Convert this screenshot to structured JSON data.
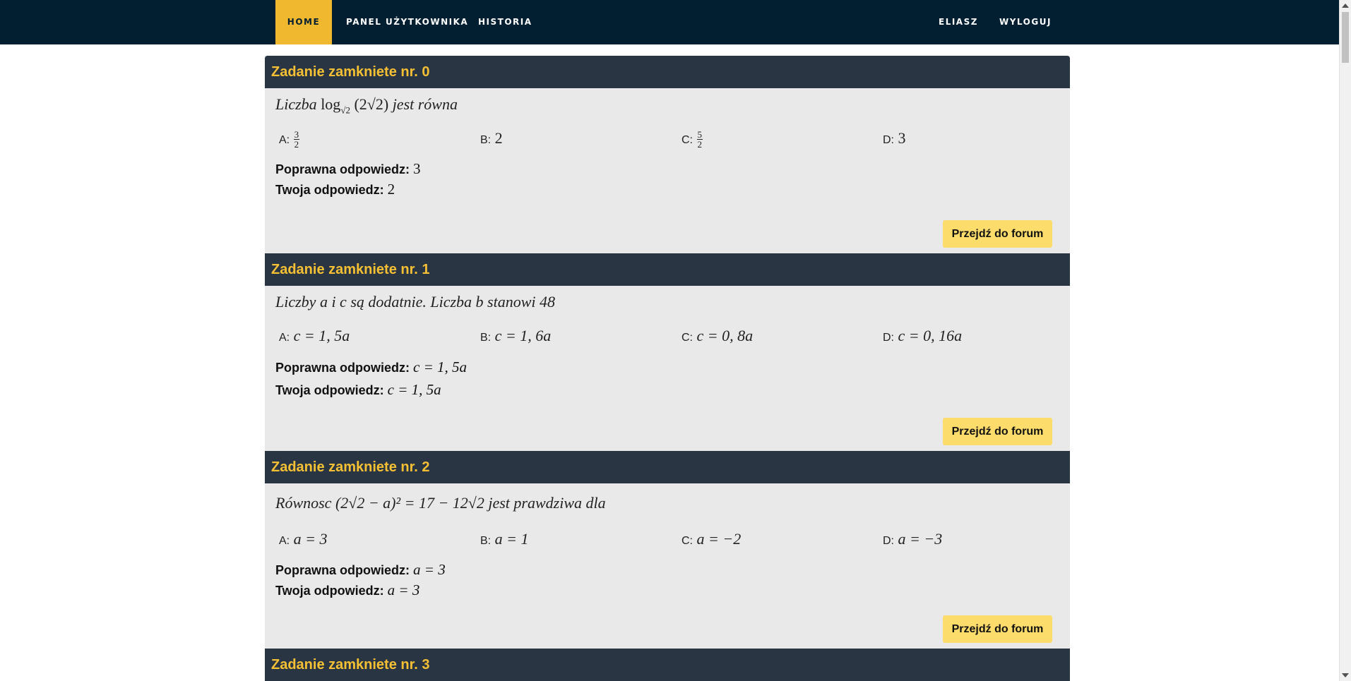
{
  "nav": {
    "left": [
      "HOME",
      "PANEL UŻYTKOWNIKA",
      "HISTORIA"
    ],
    "right": [
      "ELIASZ",
      "WYLOGUJ"
    ]
  },
  "tasks": [
    {
      "title": "Zadanie zamkniete nr. 0",
      "question_prefix": "Liczba",
      "question_math": "log√2 (2√2)",
      "question_suffix": "jest równa",
      "answers": [
        {
          "letter": "A:",
          "value": "3/2"
        },
        {
          "letter": "B:",
          "value": "2"
        },
        {
          "letter": "C:",
          "value": "5/2"
        },
        {
          "letter": "D:",
          "value": "3"
        }
      ],
      "correct_label": "Poprawna odpowiedz:",
      "correct_value": "3",
      "yours_label": "Twoja odpowiedz:",
      "yours_value": "2",
      "forum_label": "Przejdź do forum"
    },
    {
      "title": "Zadanie zamkniete nr. 1",
      "question": "Liczby a i c są dodatnie. Liczba b stanowi 48",
      "answers": [
        {
          "letter": "A:",
          "value": "c = 1, 5a"
        },
        {
          "letter": "B:",
          "value": "c = 1, 6a"
        },
        {
          "letter": "C:",
          "value": "c = 0, 8a"
        },
        {
          "letter": "D:",
          "value": "c = 0, 16a"
        }
      ],
      "correct_label": "Poprawna odpowiedz:",
      "correct_value": "c = 1, 5a",
      "yours_label": "Twoja odpowiedz:",
      "yours_value": "c = 1, 5a",
      "forum_label": "Przejdź do forum"
    },
    {
      "title": "Zadanie zamkniete nr. 2",
      "question": "Równosc (2√2 − a)² = 17 − 12√2 jest prawdziwa dla",
      "answers": [
        {
          "letter": "A:",
          "value": "a = 3"
        },
        {
          "letter": "B:",
          "value": "a = 1"
        },
        {
          "letter": "C:",
          "value": "a = −2"
        },
        {
          "letter": "D:",
          "value": "a = −3"
        }
      ],
      "correct_label": "Poprawna odpowiedz:",
      "correct_value": "a = 3",
      "yours_label": "Twoja odpowiedz:",
      "yours_value": "a = 3",
      "forum_label": "Przejdź do forum"
    },
    {
      "title": "Zadanie zamkniete nr. 3"
    }
  ],
  "colors": {
    "navbar": "#011f31",
    "active_tab": "#f0b82e",
    "task_header": "#293542",
    "task_title": "#f5c034",
    "task_body": "#e9e9e9",
    "forum_button": "#fcdc6b"
  }
}
